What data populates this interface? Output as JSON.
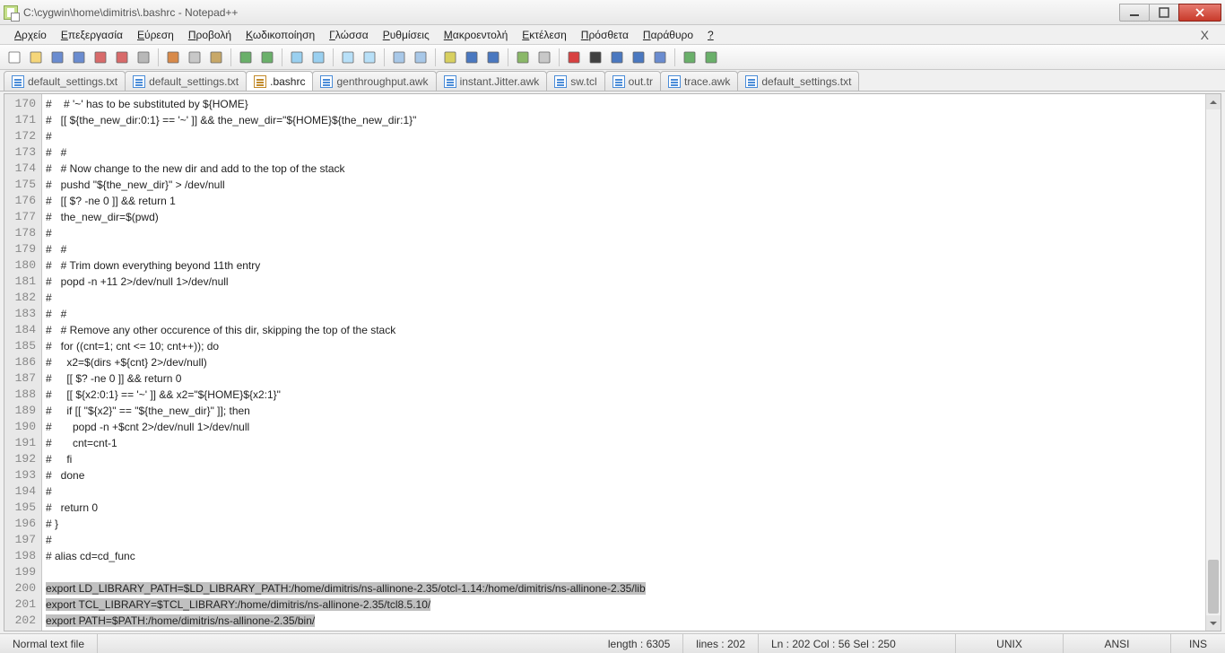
{
  "window": {
    "title": "C:\\cygwin\\home\\dimitris\\.bashrc - Notepad++"
  },
  "menu": {
    "items": [
      {
        "u": "Α",
        "rest": "ρχείο"
      },
      {
        "u": "Ε",
        "rest": "πεξεργασία"
      },
      {
        "u": "Ε",
        "rest": "ύρεση"
      },
      {
        "u": "Π",
        "rest": "ροβολή"
      },
      {
        "u": "Κ",
        "rest": "ωδικοποίηση"
      },
      {
        "u": "Γ",
        "rest": "λώσσα"
      },
      {
        "u": "Ρ",
        "rest": "υθμίσεις"
      },
      {
        "u": "Μ",
        "rest": "ακροεντολή"
      },
      {
        "u": "Ε",
        "rest": "κτέλεση"
      },
      {
        "u": "Π",
        "rest": "ρόσθετα"
      },
      {
        "u": "Π",
        "rest": "αράθυρο"
      },
      {
        "u": "?",
        "rest": ""
      }
    ],
    "close_doc": "X"
  },
  "tabs": [
    {
      "label": "default_settings.txt",
      "active": false
    },
    {
      "label": "default_settings.txt",
      "active": false
    },
    {
      "label": ".bashrc",
      "active": true
    },
    {
      "label": "genthroughput.awk",
      "active": false
    },
    {
      "label": "instant.Jitter.awk",
      "active": false
    },
    {
      "label": "sw.tcl",
      "active": false
    },
    {
      "label": "out.tr",
      "active": false
    },
    {
      "label": "trace.awk",
      "active": false
    },
    {
      "label": "default_settings.txt",
      "active": false
    }
  ],
  "editor": {
    "first_line": 170,
    "lines": [
      "#    # '~' has to be substituted by ${HOME}",
      "#   [[ ${the_new_dir:0:1} == '~' ]] && the_new_dir=\"${HOME}${the_new_dir:1}\"",
      "#",
      "#   #",
      "#   # Now change to the new dir and add to the top of the stack",
      "#   pushd \"${the_new_dir}\" > /dev/null",
      "#   [[ $? -ne 0 ]] && return 1",
      "#   the_new_dir=$(pwd)",
      "#",
      "#   #",
      "#   # Trim down everything beyond 11th entry",
      "#   popd -n +11 2>/dev/null 1>/dev/null",
      "#",
      "#   #",
      "#   # Remove any other occurence of this dir, skipping the top of the stack",
      "#   for ((cnt=1; cnt <= 10; cnt++)); do",
      "#     x2=$(dirs +${cnt} 2>/dev/null)",
      "#     [[ $? -ne 0 ]] && return 0",
      "#     [[ ${x2:0:1} == '~' ]] && x2=\"${HOME}${x2:1}\"",
      "#     if [[ \"${x2}\" == \"${the_new_dir}\" ]]; then",
      "#       popd -n +$cnt 2>/dev/null 1>/dev/null",
      "#       cnt=cnt-1",
      "#     fi",
      "#   done",
      "#",
      "#   return 0",
      "# }",
      "#",
      "# alias cd=cd_func",
      "",
      "export LD_LIBRARY_PATH=$LD_LIBRARY_PATH:/home/dimitris/ns-allinone-2.35/otcl-1.14:/home/dimitris/ns-allinone-2.35/lib",
      "export TCL_LIBRARY=$TCL_LIBRARY:/home/dimitris/ns-allinone-2.35/tcl8.5.10/",
      "export PATH=$PATH:/home/dimitris/ns-allinone-2.35/bin/"
    ],
    "highlight_from": 200,
    "highlight_to": 202
  },
  "status": {
    "filetype": "Normal text file",
    "length_label": "length : 6305",
    "lines_label": "lines : 202",
    "pos_label": "Ln : 202   Col : 56   Sel : 250",
    "eol": "UNIX",
    "encoding": "ANSI",
    "mode": "INS"
  },
  "icons": {
    "toolbar": [
      "new-file-icon",
      "open-file-icon",
      "save-icon",
      "save-all-icon",
      "close-icon",
      "close-all-icon",
      "print-icon",
      "sep",
      "cut-icon",
      "copy-icon",
      "paste-icon",
      "sep",
      "undo-icon",
      "redo-icon",
      "sep",
      "find-icon",
      "replace-icon",
      "sep",
      "zoom-in-icon",
      "zoom-out-icon",
      "sep",
      "sync-v-icon",
      "sync-h-icon",
      "sep",
      "wrap-icon",
      "all-chars-icon",
      "indent-guide-icon",
      "sep",
      "lang-icon",
      "doc-map-icon",
      "sep",
      "record-icon",
      "stop-icon",
      "play-icon",
      "play-multi-icon",
      "save-macro-icon",
      "sep",
      "spell-icon",
      "spell-next-icon"
    ]
  }
}
